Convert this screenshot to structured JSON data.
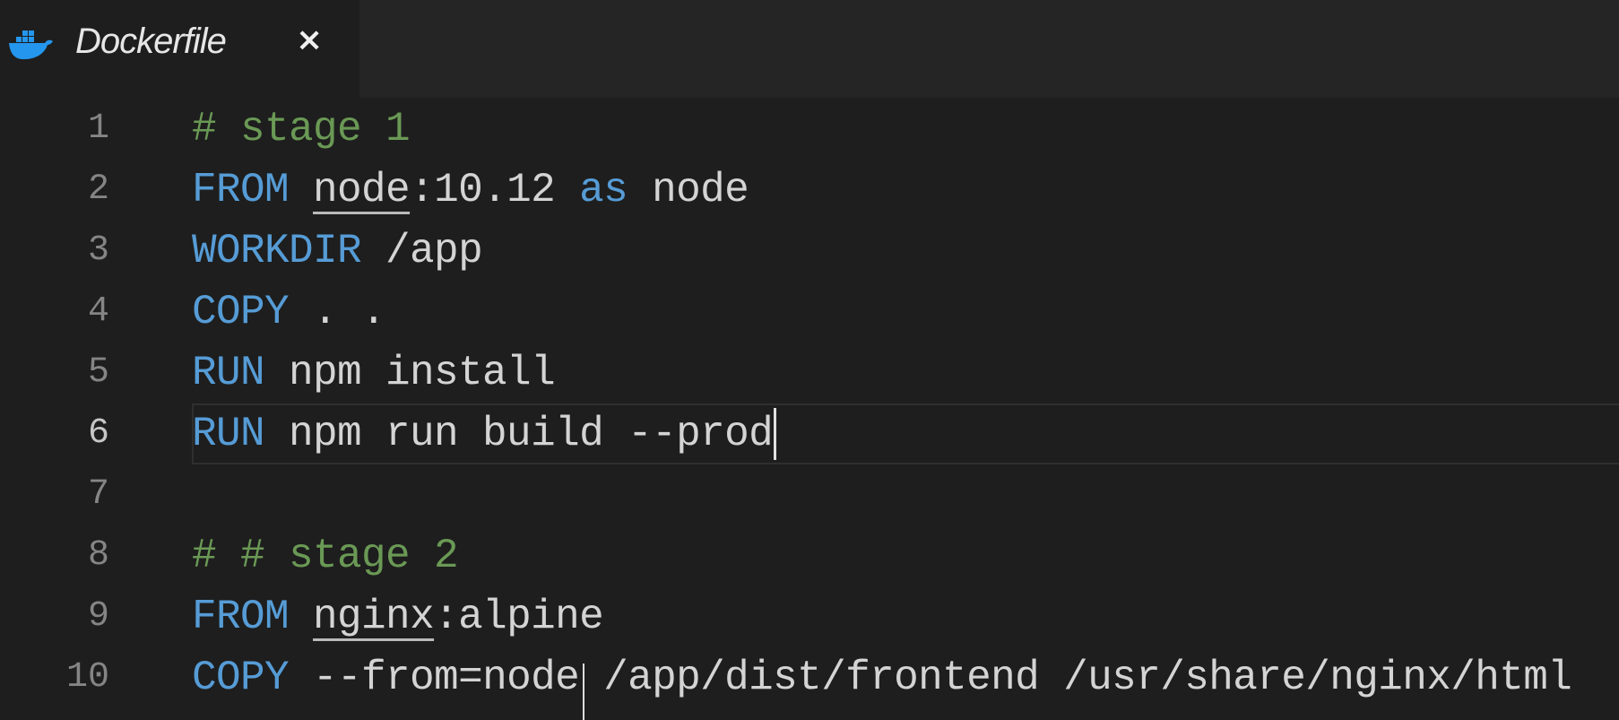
{
  "tab": {
    "label": "Dockerfile",
    "close_icon": "×",
    "icon": "docker-whale-icon",
    "icon_color": "#2496ed"
  },
  "editor": {
    "active_line": 6,
    "lines": [
      {
        "n": "1",
        "parts": [
          {
            "t": "# stage 1",
            "c": "cm"
          }
        ]
      },
      {
        "n": "2",
        "parts": [
          {
            "t": "FROM",
            "c": "kw"
          },
          {
            "t": " "
          },
          {
            "t": "node",
            "c": "ul"
          },
          {
            "t": ":10.12 "
          },
          {
            "t": "as",
            "c": "kw"
          },
          {
            "t": " node"
          }
        ]
      },
      {
        "n": "3",
        "parts": [
          {
            "t": "WORKDIR",
            "c": "kw"
          },
          {
            "t": " /app"
          }
        ]
      },
      {
        "n": "4",
        "parts": [
          {
            "t": "COPY",
            "c": "kw"
          },
          {
            "t": " . ."
          }
        ]
      },
      {
        "n": "5",
        "parts": [
          {
            "t": "RUN",
            "c": "kw"
          },
          {
            "t": " npm install"
          }
        ]
      },
      {
        "n": "6",
        "parts": [
          {
            "t": "RUN",
            "c": "kw"
          },
          {
            "t": " npm run build --prod"
          }
        ]
      },
      {
        "n": "7",
        "parts": []
      },
      {
        "n": "8",
        "parts": [
          {
            "t": "# # stage 2",
            "c": "cm"
          }
        ]
      },
      {
        "n": "9",
        "parts": [
          {
            "t": "FROM",
            "c": "kw"
          },
          {
            "t": " "
          },
          {
            "t": "nginx",
            "c": "ul"
          },
          {
            "t": ":alpine"
          }
        ]
      },
      {
        "n": "10",
        "parts": [
          {
            "t": "COPY",
            "c": "kw"
          },
          {
            "t": " --from=node /app/dist/frontend /usr/share/nginx/html"
          }
        ]
      }
    ]
  }
}
